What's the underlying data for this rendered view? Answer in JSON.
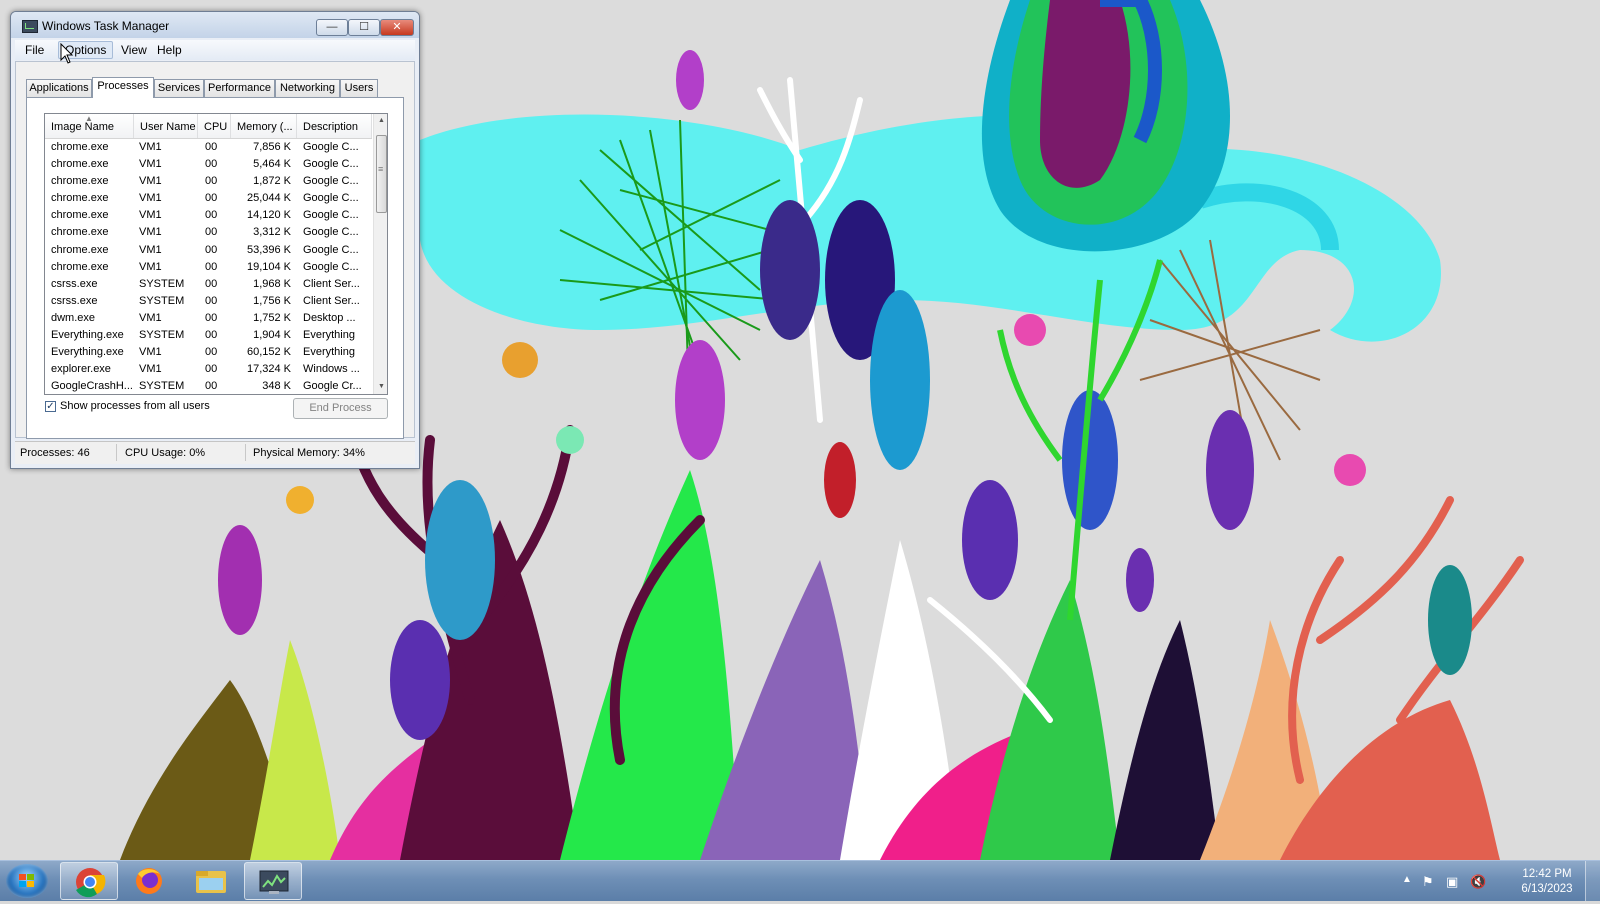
{
  "window": {
    "title": "Windows Task Manager",
    "controls": {
      "minimize": "—",
      "maximize": "☐",
      "close": "✕"
    }
  },
  "menu": [
    "File",
    "Options",
    "View",
    "Help"
  ],
  "tabs": [
    "Applications",
    "Processes",
    "Services",
    "Performance",
    "Networking",
    "Users"
  ],
  "active_tab": "Processes",
  "columns": [
    "Image Name",
    "User Name",
    "CPU",
    "Memory (...",
    "Description"
  ],
  "processes": [
    {
      "name": "chrome.exe",
      "user": "VM1",
      "cpu": "00",
      "memory": "7,856 K",
      "desc": "Google C..."
    },
    {
      "name": "chrome.exe",
      "user": "VM1",
      "cpu": "00",
      "memory": "5,464 K",
      "desc": "Google C..."
    },
    {
      "name": "chrome.exe",
      "user": "VM1",
      "cpu": "00",
      "memory": "1,872 K",
      "desc": "Google C..."
    },
    {
      "name": "chrome.exe",
      "user": "VM1",
      "cpu": "00",
      "memory": "25,044 K",
      "desc": "Google C..."
    },
    {
      "name": "chrome.exe",
      "user": "VM1",
      "cpu": "00",
      "memory": "14,120 K",
      "desc": "Google C..."
    },
    {
      "name": "chrome.exe",
      "user": "VM1",
      "cpu": "00",
      "memory": "3,312 K",
      "desc": "Google C..."
    },
    {
      "name": "chrome.exe",
      "user": "VM1",
      "cpu": "00",
      "memory": "53,396 K",
      "desc": "Google C..."
    },
    {
      "name": "chrome.exe",
      "user": "VM1",
      "cpu": "00",
      "memory": "19,104 K",
      "desc": "Google C..."
    },
    {
      "name": "csrss.exe",
      "user": "SYSTEM",
      "cpu": "00",
      "memory": "1,968 K",
      "desc": "Client Ser..."
    },
    {
      "name": "csrss.exe",
      "user": "SYSTEM",
      "cpu": "00",
      "memory": "1,756 K",
      "desc": "Client Ser..."
    },
    {
      "name": "dwm.exe",
      "user": "VM1",
      "cpu": "00",
      "memory": "1,752 K",
      "desc": "Desktop ..."
    },
    {
      "name": "Everything.exe",
      "user": "SYSTEM",
      "cpu": "00",
      "memory": "1,904 K",
      "desc": "Everything"
    },
    {
      "name": "Everything.exe",
      "user": "VM1",
      "cpu": "00",
      "memory": "60,152 K",
      "desc": "Everything"
    },
    {
      "name": "explorer.exe",
      "user": "VM1",
      "cpu": "00",
      "memory": "17,324 K",
      "desc": "Windows ..."
    },
    {
      "name": "GoogleCrashH...",
      "user": "SYSTEM",
      "cpu": "00",
      "memory": "348 K",
      "desc": "Google Cr..."
    }
  ],
  "show_all_users": {
    "label": "Show processes from all users",
    "checked": true,
    "check_glyph": "✓"
  },
  "end_process_label": "End Process",
  "status": {
    "processes": "Processes: 46",
    "cpu": "CPU Usage: 0%",
    "memory": "Physical Memory: 34%"
  },
  "taskbar": {
    "apps": [
      {
        "icon": "chrome-icon",
        "active": true
      },
      {
        "icon": "firefox-icon",
        "active": false
      },
      {
        "icon": "folder-icon",
        "active": false
      },
      {
        "icon": "task-manager-icon",
        "active": true
      }
    ],
    "clock_time": "12:42 PM",
    "clock_date": "6/13/2023"
  }
}
